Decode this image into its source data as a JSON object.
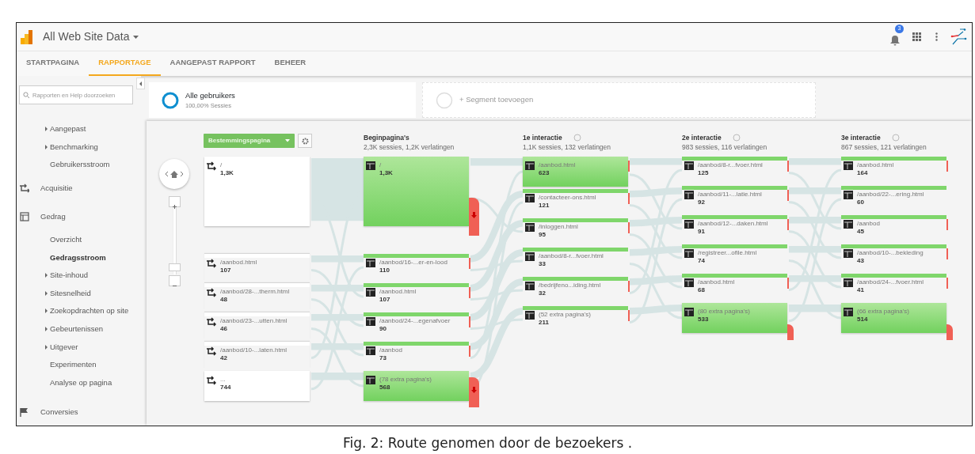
{
  "header": {
    "title": "All Web Site Data",
    "notification_count": "3"
  },
  "tabs": [
    {
      "label": "STARTPAGINA",
      "selected": false
    },
    {
      "label": "RAPPORTAGE",
      "selected": true
    },
    {
      "label": "AANGEPAST RAPPORT",
      "selected": false
    },
    {
      "label": "BEHEER",
      "selected": false
    }
  ],
  "sidebar": {
    "search": {
      "placeholder": "Rapporten en Help doorzoeken"
    },
    "groups": [
      {
        "kind": "continued",
        "children": [
          {
            "label": "Aangepast",
            "collapsed": true,
            "selected": false
          },
          {
            "label": "Benchmarking",
            "collapsed": true,
            "selected": false
          },
          {
            "label": "Gebruikersstroom",
            "collapsed": false,
            "selected": false
          }
        ]
      },
      {
        "kind": "acquisition",
        "label": "Acquisitie"
      },
      {
        "kind": "behavior",
        "label": "Gedrag",
        "children": [
          {
            "label": "Overzicht",
            "collapsed": false,
            "selected": false
          },
          {
            "label": "Gedragsstroom",
            "collapsed": false,
            "selected": true
          },
          {
            "label": "Site-inhoud",
            "collapsed": true,
            "selected": false
          },
          {
            "label": "Sitesnelheid",
            "collapsed": true,
            "selected": false
          },
          {
            "label": "Zoekopdrachten op site",
            "collapsed": true,
            "selected": false
          },
          {
            "label": "Gebeurtenissen",
            "collapsed": true,
            "selected": false
          },
          {
            "label": "Uitgever",
            "collapsed": true,
            "selected": false
          },
          {
            "label": "Experimenten",
            "collapsed": false,
            "selected": false
          },
          {
            "label": "Analyse op pagina",
            "collapsed": false,
            "selected": false
          }
        ]
      },
      {
        "kind": "conversions",
        "label": "Conversies"
      }
    ]
  },
  "zoom": {
    "level": 0.05
  },
  "segments": [
    {
      "kind": "segment",
      "label": "Alle gebruikers",
      "detail": "100,00% Sessies"
    },
    {
      "kind": "add",
      "label": "+ Segment toevoegen"
    }
  ],
  "flow": {
    "dimension": "Bestemmingspagina",
    "columns": [
      {
        "kind": "source",
        "nodes": [
          {
            "kind": "large-block",
            "label": "/",
            "value": "1,3K"
          },
          {
            "kind": "bar",
            "label": "/aanbod.html",
            "value": "107"
          },
          {
            "kind": "bar",
            "label": "/aanbod/28-...therm.html",
            "value": "48"
          },
          {
            "kind": "bar",
            "label": "/aanbod/23-...utten.html",
            "value": "46"
          },
          {
            "kind": "bar",
            "label": "/aanbod/10-...laten.html",
            "value": "42"
          },
          {
            "kind": "block",
            "label": "...",
            "value": "744"
          }
        ]
      },
      {
        "kind": "page",
        "title": "Beginpagina's",
        "subtitle": "2,3K sessies, 1,2K verlatingen",
        "nodes": [
          {
            "kind": "large-block",
            "label": "/",
            "value": "1,3K",
            "dropoff": {
              "kind": "large"
            }
          },
          {
            "kind": "bar",
            "label": "/aanbod/16-...er-en-lood",
            "value": "110",
            "dropoff": {
              "kind": "small"
            }
          },
          {
            "kind": "bar",
            "label": "/aanbod.html",
            "value": "107",
            "dropoff": {
              "kind": "small"
            }
          },
          {
            "kind": "bar",
            "label": "/aanbod/24-...egenafvoer",
            "value": "90",
            "dropoff": {
              "kind": "small"
            }
          },
          {
            "kind": "bar",
            "label": "/aanbod",
            "value": "73",
            "dropoff": {
              "kind": "small"
            }
          },
          {
            "kind": "block",
            "label": "(78 extra pagina's)",
            "value": "568",
            "dropoff": {
              "kind": "large"
            }
          }
        ]
      },
      {
        "kind": "page",
        "title": "1e interactie",
        "subtitle": "1,1K sessies, 132 verlatingen",
        "info": true,
        "nodes": [
          {
            "kind": "block",
            "label": "/aanbod.html",
            "value": "623",
            "dropoff": {
              "kind": "small"
            }
          },
          {
            "kind": "bar",
            "label": "/contacteer-ons.html",
            "value": "121",
            "dropoff": {
              "kind": "small"
            }
          },
          {
            "kind": "bar",
            "label": "/inloggen.html",
            "value": "95",
            "dropoff": {
              "kind": "small"
            }
          },
          {
            "kind": "bar",
            "label": "/aanbod/8-r...fvoer.html",
            "value": "33"
          },
          {
            "kind": "bar",
            "label": "/bedrijfeno...iding.html",
            "value": "32",
            "dropoff": {
              "kind": "small"
            }
          },
          {
            "kind": "bar",
            "label": "(52 extra pagina's)",
            "value": "211",
            "dropoff": {
              "kind": "small"
            }
          }
        ]
      },
      {
        "kind": "page",
        "title": "2e interactie",
        "subtitle": "983 sessies, 116 verlatingen",
        "info": true,
        "nodes": [
          {
            "kind": "bar",
            "label": "/aanbod/8-r...fvoer.html",
            "value": "125",
            "dropoff": {
              "kind": "small"
            }
          },
          {
            "kind": "bar",
            "label": "/aanbod/11-...latie.html",
            "value": "92",
            "dropoff": {
              "kind": "small"
            }
          },
          {
            "kind": "bar",
            "label": "/aanbod/12-...daken.html",
            "value": "91",
            "dropoff": {
              "kind": "small"
            }
          },
          {
            "kind": "bar",
            "label": "/registreer...ofile.html",
            "value": "74"
          },
          {
            "kind": "bar",
            "label": "/aanbod.html",
            "value": "68",
            "dropoff": {
              "kind": "small"
            }
          },
          {
            "kind": "block",
            "label": "(80 extra pagina's)",
            "value": "533",
            "dropoff": {
              "kind": "tab"
            }
          }
        ]
      },
      {
        "kind": "page",
        "title": "3e interactie",
        "subtitle": "867 sessies, 121 verlatingen",
        "info": true,
        "nodes": [
          {
            "kind": "bar",
            "label": "/aanbod.html",
            "value": "164",
            "dropoff": {
              "kind": "small"
            }
          },
          {
            "kind": "bar",
            "label": "/aanbod/22-...ering.html",
            "value": "60"
          },
          {
            "kind": "bar",
            "label": "/aanbod",
            "value": "45",
            "dropoff": {
              "kind": "small"
            }
          },
          {
            "kind": "bar",
            "label": "/aanbod/10-...bekleding",
            "value": "43",
            "dropoff": {
              "kind": "small"
            }
          },
          {
            "kind": "bar",
            "label": "/aanbod/24-...fvoer.html",
            "value": "41",
            "dropoff": {
              "kind": "small"
            }
          },
          {
            "kind": "block",
            "label": "(66 extra pagina's)",
            "value": "514",
            "dropoff": {
              "kind": "tab"
            }
          }
        ]
      }
    ]
  },
  "caption": "Fig. 2: Route genomen door de bezoekers ."
}
